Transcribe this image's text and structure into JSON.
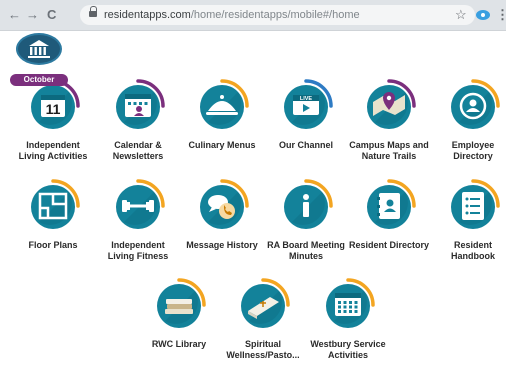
{
  "browser": {
    "back_glyph": "←",
    "forward_glyph": "→",
    "reload_glyph": "C",
    "url_domain": "residentapps.com",
    "url_path": "/home/residentapps/mobile#/home",
    "bookmark_glyph": "☆",
    "menu_glyph": "⋮"
  },
  "colors": {
    "teal": "#13829a",
    "teal_dark": "#0c6a7f",
    "ring_orange": "#f3a521",
    "ring_purple": "#7b2f7d",
    "ring_blue": "#2e7bc4"
  },
  "tiles": [
    {
      "label": "Independent Living Activities",
      "icon": "calendar-date-icon",
      "ring": "purple",
      "month": "October",
      "day": "11"
    },
    {
      "label": "Calendar & Newsletters",
      "icon": "calendar-person-icon",
      "ring": "purple"
    },
    {
      "label": "Culinary Menus",
      "icon": "cloche-icon",
      "ring": "orange"
    },
    {
      "label": "Our Channel",
      "icon": "live-video-icon",
      "ring": "blue",
      "tag": "LIVE"
    },
    {
      "label": "Campus Maps and Nature Trails",
      "icon": "map-pin-icon",
      "ring": "purple"
    },
    {
      "label": "Employee Directory",
      "icon": "employee-badge-icon",
      "ring": "orange"
    },
    {
      "label": "Floor Plans",
      "icon": "floor-plan-icon",
      "ring": "orange"
    },
    {
      "label": "Independent Living Fitness",
      "icon": "dumbbell-icon",
      "ring": "orange"
    },
    {
      "label": "Message History",
      "icon": "chat-phone-icon",
      "ring": "orange"
    },
    {
      "label": "RA Board Meeting Minutes",
      "icon": "info-icon",
      "ring": "orange"
    },
    {
      "label": "Resident Directory",
      "icon": "address-book-icon",
      "ring": "orange"
    },
    {
      "label": "Resident Handbook",
      "icon": "handbook-icon",
      "ring": "orange"
    },
    {
      "label": "RWC Library",
      "icon": "books-icon",
      "ring": "orange"
    },
    {
      "label": "Spiritual Wellness/Pasto...",
      "icon": "bible-icon",
      "ring": "orange"
    },
    {
      "label": "Westbury Service Activities",
      "icon": "calendar-grid-icon",
      "ring": "orange"
    }
  ]
}
